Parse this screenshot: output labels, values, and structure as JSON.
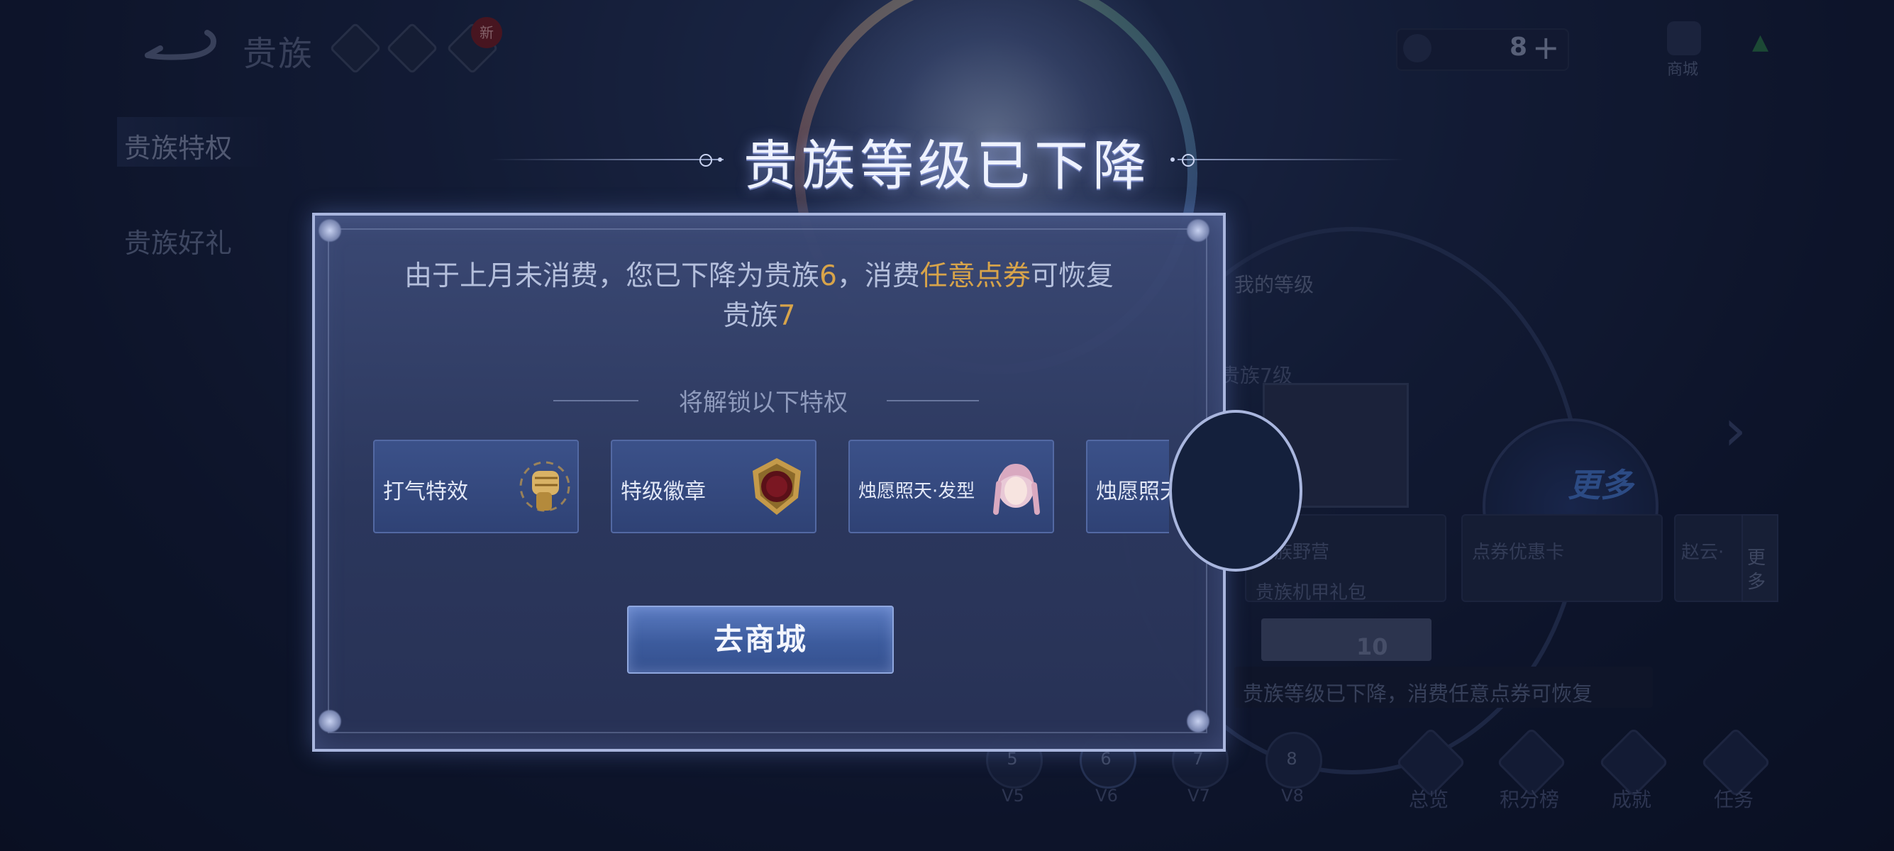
{
  "header": {
    "title": "贵族",
    "new_badge": "新",
    "currency_value": "8",
    "plus": "+",
    "shop_label": "商城"
  },
  "sidebar": {
    "items": [
      {
        "label": "贵族特权"
      },
      {
        "label": "贵族好礼"
      }
    ]
  },
  "background": {
    "tab_mine": "我的等级",
    "level_hint": "贵族7级",
    "more_label": "更多",
    "cards": [
      {
        "title": "贵族野营",
        "subtitle": "贵族机甲礼包"
      },
      {
        "title": "点券优惠卡"
      },
      {
        "title": "赵云·"
      }
    ],
    "more_vertical": "更多",
    "price": "10",
    "tooltip": "贵族等级已下降，消费任意点券可恢复",
    "levels": [
      {
        "num": "5",
        "label": "V5"
      },
      {
        "num": "6",
        "label": "V6"
      },
      {
        "num": "7",
        "label": "V7"
      },
      {
        "num": "8",
        "label": "V8"
      }
    ],
    "nav": [
      {
        "label": "总览"
      },
      {
        "label": "积分榜"
      },
      {
        "label": "成就"
      },
      {
        "label": "任务"
      }
    ]
  },
  "dialog": {
    "title": "贵族等级已下降",
    "message": {
      "part1": "由于上月未消费，您已下降为贵族",
      "level_now": "6",
      "part2": "，消费",
      "highlight": "任意点券",
      "part3": "可恢复",
      "part4": "贵族",
      "level_restore": "7"
    },
    "unlock_heading": "将解锁以下特权",
    "perks": [
      {
        "label": "打气特效",
        "icon": "fist-icon"
      },
      {
        "label": "特级徽章",
        "icon": "badge-icon"
      },
      {
        "label": "烛愿照天·发型",
        "icon": "hairstyle-icon"
      },
      {
        "label": "烛愿照天",
        "icon": "unknown"
      }
    ],
    "button_label": "去商城"
  },
  "colors": {
    "gold": "#d8a44a",
    "panel": "#2c385e",
    "button": "#3c5b9d"
  }
}
